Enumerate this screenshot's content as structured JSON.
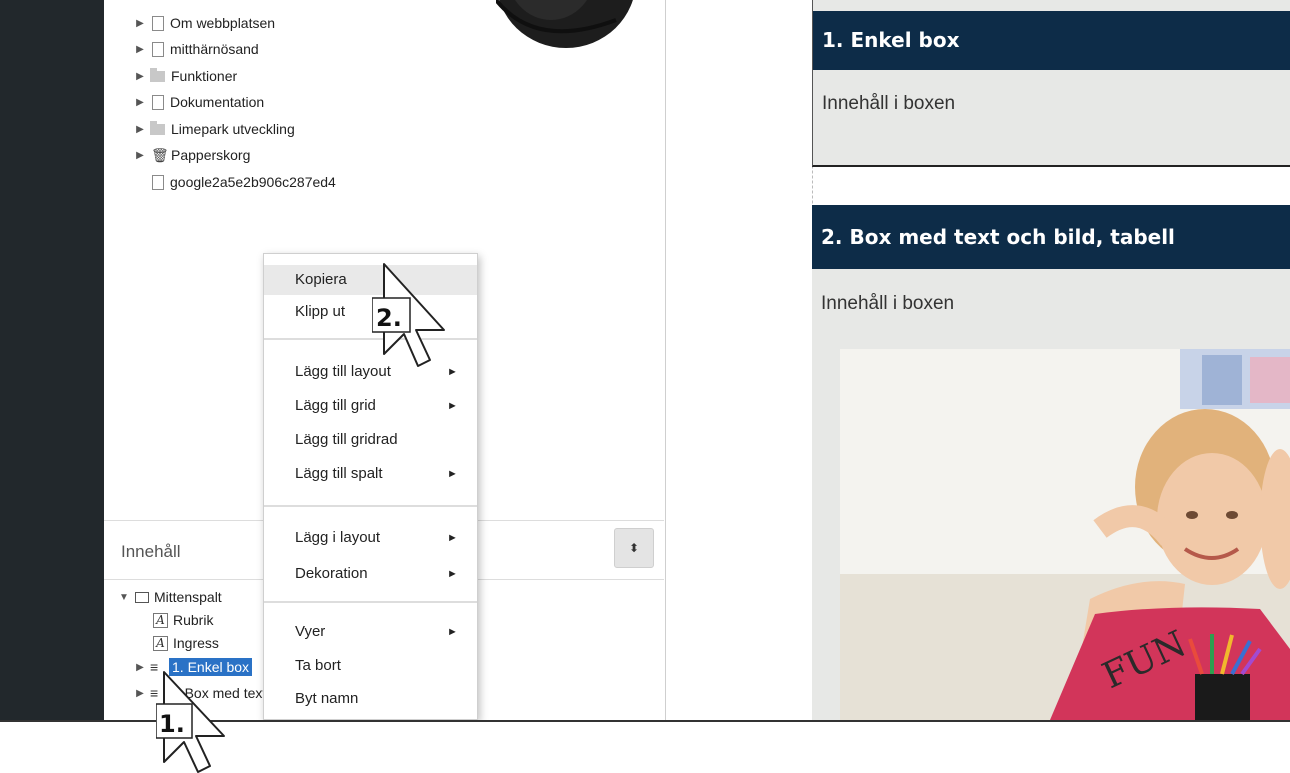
{
  "site_tree": {
    "items": [
      {
        "label": "Om webbplatsen",
        "icon": "page-icon",
        "expandable": true
      },
      {
        "label": "mitthärnösand",
        "icon": "page-icon",
        "expandable": true
      },
      {
        "label": "Funktioner",
        "icon": "folder-icon",
        "expandable": true
      },
      {
        "label": "Dokumentation",
        "icon": "page-icon",
        "expandable": true
      },
      {
        "label": "Limepark utveckling",
        "icon": "folder-icon",
        "expandable": true
      },
      {
        "label": "Papperskorg",
        "icon": "trash-icon",
        "expandable": true
      },
      {
        "label": "google2a5e2b906c287ed4",
        "icon": "page-icon",
        "expandable": false
      }
    ]
  },
  "content_panel": {
    "title": "Innehåll",
    "sort_button_icon": "sort-icon",
    "tree": [
      {
        "label": "Mittenspalt",
        "icon": "box-icon",
        "state": "expanded"
      },
      {
        "label": "Rubrik",
        "icon": "text-a-icon"
      },
      {
        "label": "Ingress",
        "icon": "text-a-icon"
      },
      {
        "label": "1. Enkel box",
        "icon": "lines-icon",
        "selected": true
      },
      {
        "label": "2. Box med text och bild, tabell",
        "icon": "lines-icon"
      }
    ]
  },
  "context_menu": {
    "items": [
      {
        "label": "Kopiera",
        "highlighted": true
      },
      {
        "label": "Klipp ut"
      },
      {
        "label": "Lägg till layout",
        "submenu": true
      },
      {
        "label": "Lägg till grid",
        "submenu": true
      },
      {
        "label": "Lägg till gridrad"
      },
      {
        "label": "Lägg till spalt",
        "submenu": true
      },
      {
        "label": "Lägg i layout",
        "submenu": true
      },
      {
        "label": "Dekoration",
        "submenu": true
      },
      {
        "label": "Vyer",
        "submenu": true
      },
      {
        "label": "Ta bort"
      },
      {
        "label": "Byt namn"
      }
    ],
    "submenu_arrow": "►"
  },
  "preview": {
    "box1": {
      "title": "1. Enkel box",
      "body": "Innehåll i boxen"
    },
    "box2": {
      "title": "2. Box med text och bild, tabell",
      "body": "Innehåll i boxen"
    },
    "header_color": "#0d2c48",
    "box_bg_color": "#e7e8e6"
  },
  "annotations": {
    "step1": "1.",
    "step2": "2."
  },
  "colors": {
    "rail": "#22282c",
    "selection": "#2a72c6"
  }
}
